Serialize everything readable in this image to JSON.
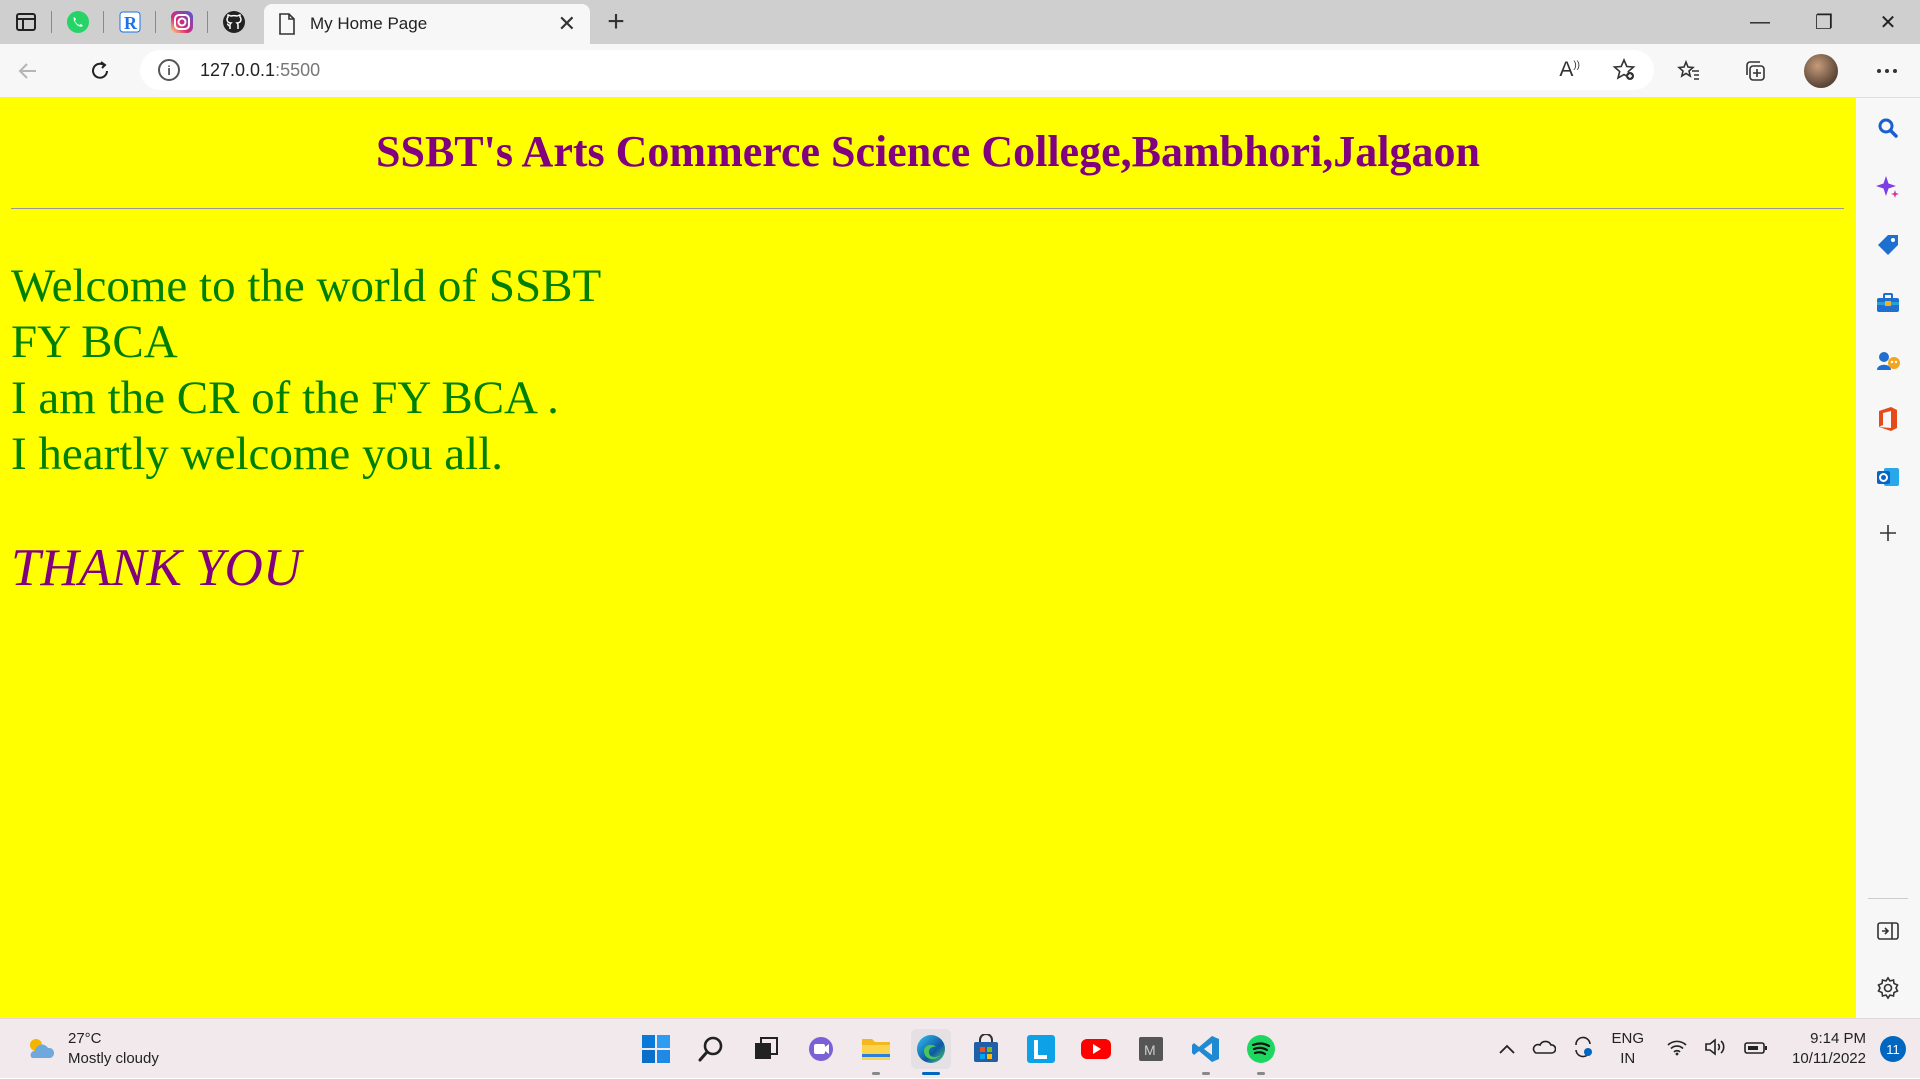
{
  "browser": {
    "tab": {
      "title": "My Home Page",
      "close": "✕"
    },
    "new_tab": "+",
    "url_host": "127.0.0.1",
    "url_port": ":5500",
    "read_aloud_label": "A",
    "window": {
      "minimize": "—",
      "restore": "❐",
      "close": "✕"
    }
  },
  "page": {
    "heading": "SSBT's Arts Commerce Science College,Bambhori,Jalgaon",
    "lines": [
      "Welcome to the world of SSBT",
      "FY BCA",
      "I am the CR of the FY BCA .",
      "I heartly welcome you all."
    ],
    "thanks": "THANK YOU",
    "colors": {
      "background": "#ffff00",
      "heading": "#800080",
      "body": "#008000"
    }
  },
  "taskbar": {
    "weather": {
      "temp": "27°C",
      "condition": "Mostly cloudy"
    },
    "language": {
      "line1": "ENG",
      "line2": "IN"
    },
    "clock": {
      "time": "9:14 PM",
      "date": "10/11/2022"
    },
    "notifications": "11"
  }
}
